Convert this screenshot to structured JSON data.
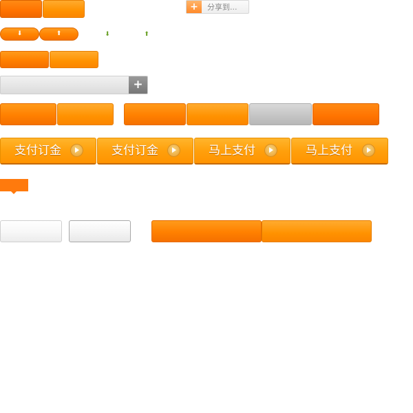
{
  "share": {
    "icon": "plus-icon",
    "label": "分享到..."
  },
  "pill_buttons": {
    "down_icon": "arrow-down-icon",
    "up_icon": "arrow-up-icon",
    "down_glyph": "⬇",
    "up_glyph": "⬆"
  },
  "input_bar": {
    "value": "",
    "add_glyph": "+",
    "add_icon": "plus-icon"
  },
  "pay_buttons": [
    {
      "label": "支付订金"
    },
    {
      "label": "支付订金"
    },
    {
      "label": "马上支付"
    },
    {
      "label": "马上支付"
    }
  ],
  "colors": {
    "accent_orange": "#ff8000",
    "pay_orange": "#ffa00c",
    "gray_button": "#c4c4c4",
    "green_arrow": "#6ca22a"
  }
}
